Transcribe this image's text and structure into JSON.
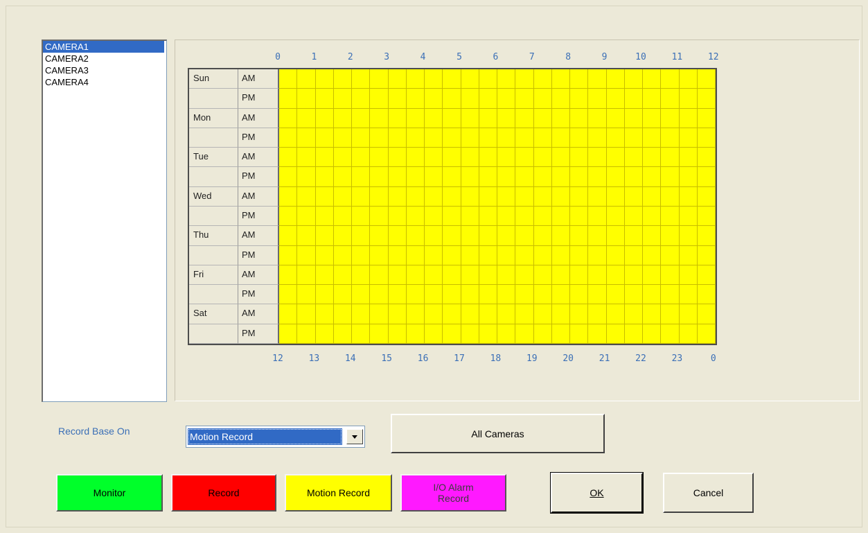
{
  "cameras": {
    "items": [
      {
        "label": "CAMERA1",
        "selected": true
      },
      {
        "label": "CAMERA2",
        "selected": false
      },
      {
        "label": "CAMERA3",
        "selected": false
      },
      {
        "label": "CAMERA4",
        "selected": false
      }
    ]
  },
  "schedule": {
    "top_hours": [
      "0",
      "1",
      "2",
      "3",
      "4",
      "5",
      "6",
      "7",
      "8",
      "9",
      "10",
      "11",
      "12"
    ],
    "bottom_hours": [
      "12",
      "13",
      "14",
      "15",
      "16",
      "17",
      "18",
      "19",
      "20",
      "21",
      "22",
      "23",
      "0"
    ],
    "rows": [
      {
        "day": "Sun",
        "period": "AM"
      },
      {
        "day": "",
        "period": "PM"
      },
      {
        "day": "Mon",
        "period": "AM"
      },
      {
        "day": "",
        "period": "PM"
      },
      {
        "day": "Tue",
        "period": "AM"
      },
      {
        "day": "",
        "period": "PM"
      },
      {
        "day": "Wed",
        "period": "AM"
      },
      {
        "day": "",
        "period": "PM"
      },
      {
        "day": "Thu",
        "period": "AM"
      },
      {
        "day": "",
        "period": "PM"
      },
      {
        "day": "Fri",
        "period": "AM"
      },
      {
        "day": "",
        "period": "PM"
      },
      {
        "day": "Sat",
        "period": "AM"
      },
      {
        "day": "",
        "period": "PM"
      }
    ],
    "slots_per_row": 24,
    "fill_mode": "Motion Record",
    "fill_color": "#ffff00"
  },
  "record_base": {
    "label": "Record Base On",
    "selected": "Motion Record"
  },
  "all_cameras_label": "All Cameras",
  "modes": {
    "monitor": {
      "label": "Monitor",
      "color": "#00ff2a"
    },
    "record": {
      "label": "Record",
      "color": "#ff0000"
    },
    "motion_record": {
      "label": "Motion Record",
      "color": "#ffff00"
    },
    "io_alarm_record": {
      "label": "I/O Alarm Record",
      "color": "#ff19ff"
    }
  },
  "ok_label": "OK",
  "cancel_label": "Cancel"
}
